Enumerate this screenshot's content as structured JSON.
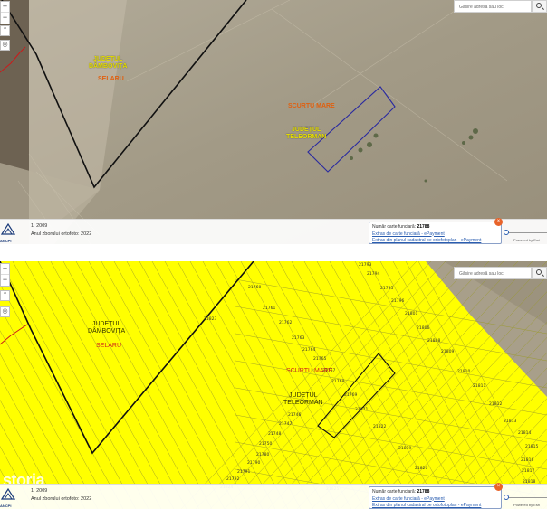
{
  "colors": {
    "satellite_field": "#a8a08e",
    "parcel_fill": "#ffff00",
    "boundary_black": "#111111",
    "boundary_red": "#cc1a1a",
    "parcel_outline": "#2a2aa0",
    "accent_link": "#2a5db0",
    "close_orange": "#e8632a"
  },
  "search": {
    "placeholder": "Găsire adresă sau loc",
    "icon": "search-icon"
  },
  "controls": {
    "zoom_in": "+",
    "zoom_out": "−",
    "tool_1": "⇡",
    "tool_2": "◎"
  },
  "map_top": {
    "county_1": "JUDEȚUL\nDÂMBOVIȚA",
    "locality_1": "SELARU",
    "locality_2": "SCURTU MARE",
    "county_2": "JUDEȚUL\nTELEORMAN"
  },
  "map_bottom": {
    "county_1": "JUDEȚUL\nDÂMBOVIȚA",
    "locality_1": "SELARU",
    "locality_2": "SCURTU MARE",
    "county_2": "JUDEȚUL\nTELEORMAN",
    "parcels": [
      "21760",
      "21761",
      "21762",
      "21763",
      "21764",
      "21765",
      "21767",
      "21768",
      "21769",
      "21746",
      "21747",
      "21748",
      "21750",
      "21780",
      "21790",
      "21791",
      "21792",
      "21793",
      "21794",
      "21795",
      "21796",
      "21801",
      "21806",
      "21808",
      "21809",
      "21810",
      "21811",
      "21812",
      "21813",
      "21814",
      "21815",
      "21816",
      "21817",
      "21818",
      "21819",
      "21820",
      "21821",
      "21822",
      "21823",
      "21824",
      "21825",
      "21826",
      "21827"
    ]
  },
  "bottom_bar": {
    "logo": "ANCPI",
    "scale": "1: 2009",
    "ortho_year": "Anul zborului ortofoto: 2022"
  },
  "info": {
    "cf_label": "Număr carte funciară:",
    "cf_value": "21788",
    "link_1": "Extras de carte funciară - ePayment",
    "link_2": "Extras din planul cadastral pe ortofotoplan - ePayment",
    "close": "×"
  },
  "powered": "Powered by Esri",
  "watermark": "storia"
}
